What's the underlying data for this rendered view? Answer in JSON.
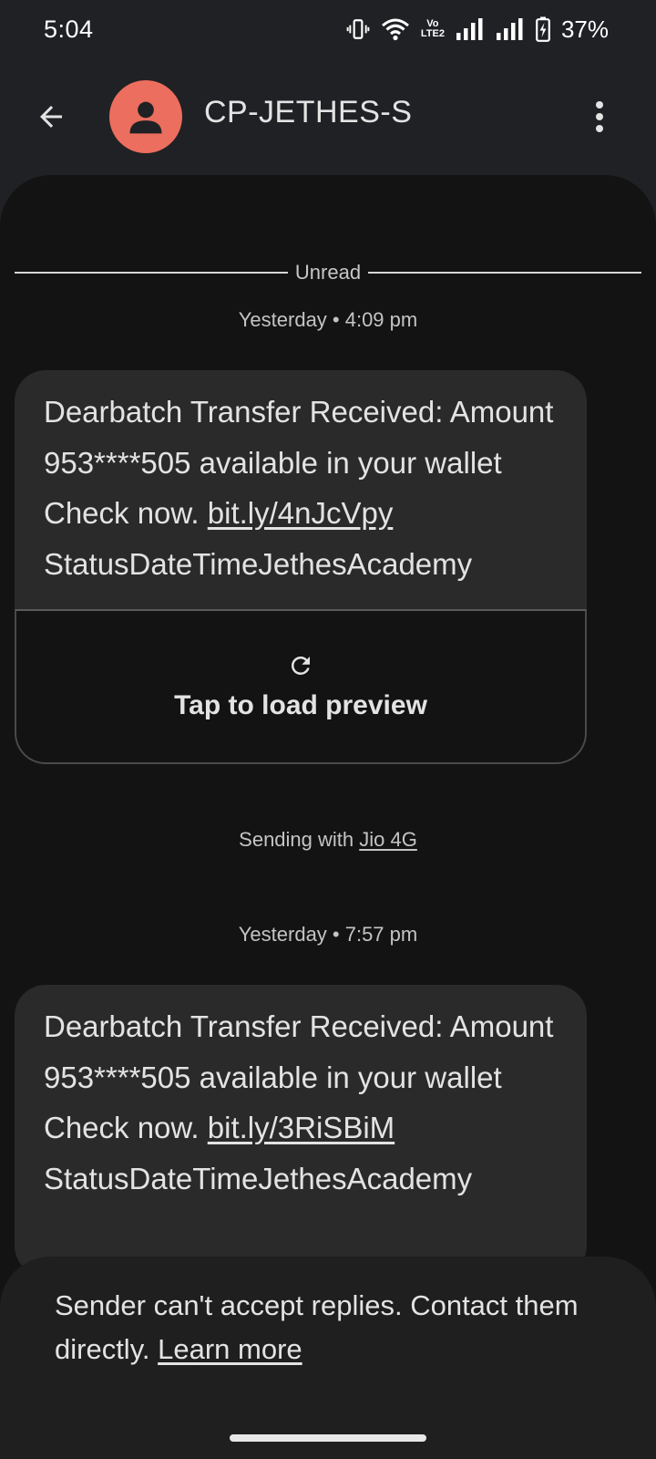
{
  "status_bar": {
    "time": "5:04",
    "volte_top": "Vo",
    "volte_bottom": "LTE2",
    "battery_percent": "37%"
  },
  "header": {
    "contact_name": "CP-JETHES-S",
    "avatar_color": "#ec6e5e"
  },
  "conversation": {
    "unread_label": "Unread",
    "messages": [
      {
        "timestamp": "Yesterday • 4:09 pm",
        "text_before_link": "Dearbatch Transfer Received: Amount 953****505 available in your wallet Check now. ",
        "link": "bit.ly/4nJcVpy",
        "text_after_link": " StatusDateTimeJethesAcademy",
        "preview_label": "Tap to load preview",
        "sending_prefix": "Sending with ",
        "sending_carrier": "Jio 4G"
      },
      {
        "timestamp": "Yesterday • 7:57 pm",
        "text_before_link": "Dearbatch Transfer Received: Amount 953****505 available in your wallet Check now. ",
        "link": "bit.ly/3RiSBiM",
        "text_after_link": " StatusDateTimeJethesAcademy"
      }
    ]
  },
  "reply_notice": {
    "text": "Sender can't accept replies. Contact them directly. ",
    "link": "Learn more"
  },
  "icons": {
    "back": "arrow-back-icon",
    "overflow": "more-vert-icon",
    "refresh": "refresh-icon",
    "vibrate": "vibrate-icon",
    "wifi": "wifi-icon",
    "signal": "signal-icon",
    "battery": "battery-charging-icon"
  }
}
